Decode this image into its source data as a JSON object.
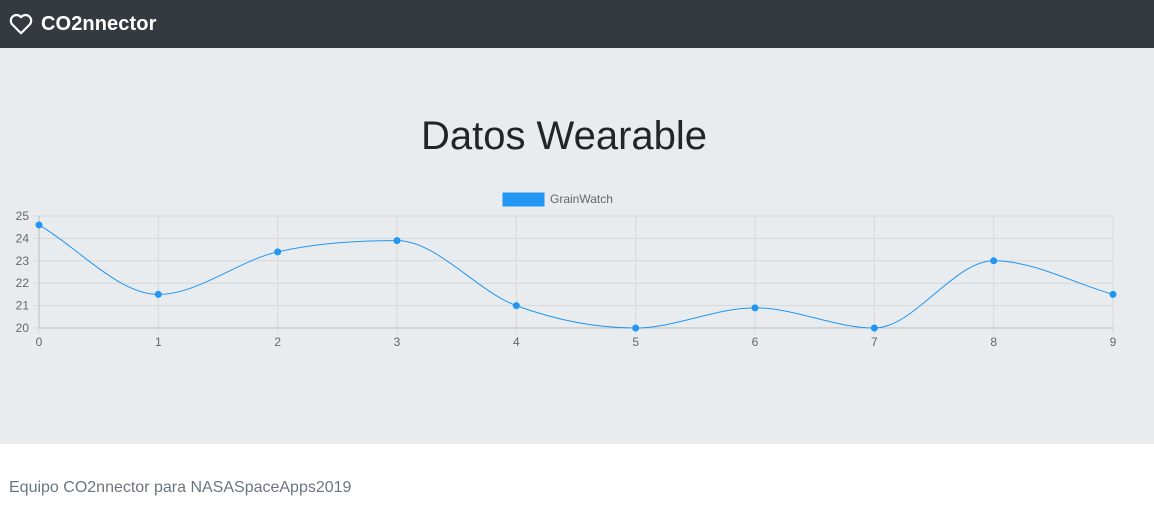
{
  "navbar": {
    "brand_text": "CO2nnector",
    "brand_icon": "heart-outline-icon"
  },
  "main": {
    "title": "Datos Wearable"
  },
  "colors": {
    "navbar_bg": "#343a40",
    "jumbotron_bg": "#e9ecef",
    "series": "#2196f3",
    "grid": "#d8d8d8"
  },
  "chart_data": {
    "type": "line",
    "x": [
      0,
      1,
      2,
      3,
      4,
      5,
      6,
      7,
      8,
      9
    ],
    "series": [
      {
        "name": "GrainWatch",
        "values": [
          24.6,
          21.5,
          23.4,
          23.9,
          21.0,
          20.0,
          20.9,
          20.0,
          23.0,
          21.5
        ]
      }
    ],
    "ylim": [
      20,
      25
    ],
    "yticks": [
      20,
      21,
      22,
      23,
      24,
      25
    ],
    "xticks": [
      0,
      1,
      2,
      3,
      4,
      5,
      6,
      7,
      8,
      9
    ],
    "grid": true,
    "legend": "top-center",
    "smooth": true
  },
  "footer": {
    "text": "Equipo CO2nnector para NASASpaceApps2019"
  }
}
